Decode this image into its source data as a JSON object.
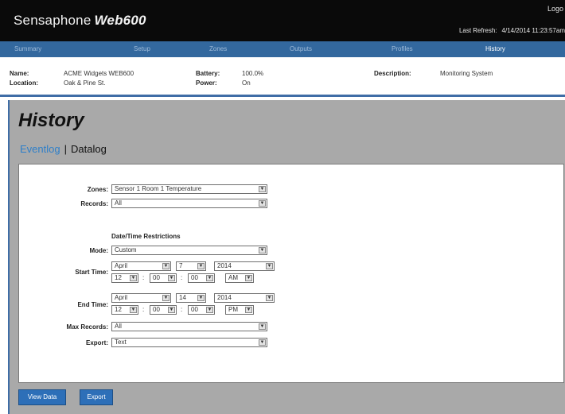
{
  "header": {
    "brand": "Sensaphone",
    "model": "Web600",
    "logout": "Logo",
    "last_refresh_label": "Last Refresh:",
    "last_refresh_value": "4/14/2014 11:23:57am"
  },
  "nav": {
    "items": [
      "Summary",
      "Setup",
      "Zones",
      "Outputs",
      "Profiles",
      "History"
    ],
    "active": "History"
  },
  "device": {
    "name_label": "Name:",
    "name_value": "ACME Widgets WEB600",
    "location_label": "Location:",
    "location_value": "Oak & Pine St.",
    "battery_label": "Battery:",
    "battery_value": "100.0%",
    "power_label": "Power:",
    "power_value": "On",
    "description_label": "Description:",
    "description_value": "Monitoring System"
  },
  "page": {
    "title": "History",
    "subnav_eventlog": "Eventlog",
    "subnav_sep": "|",
    "subnav_datalog": "Datalog"
  },
  "form": {
    "zones_label": "Zones:",
    "zones_value": "Sensor 1 Room 1 Temperature",
    "records_label": "Records:",
    "records_value": "All",
    "restrictions_heading": "Date/Time Restrictions",
    "mode_label": "Mode:",
    "mode_value": "Custom",
    "start_label": "Start Time:",
    "start": {
      "month": "April",
      "day": "7",
      "year": "2014",
      "hour": "12",
      "minute": "00",
      "second": "00",
      "ampm": "AM"
    },
    "end_label": "End Time:",
    "end": {
      "month": "April",
      "day": "14",
      "year": "2014",
      "hour": "12",
      "minute": "00",
      "second": "00",
      "ampm": "PM"
    },
    "max_records_label": "Max Records:",
    "max_records_value": "All",
    "export_label": "Export:",
    "export_value": "Text"
  },
  "buttons": {
    "view_data": "View Data",
    "export": "Export"
  },
  "colors": {
    "header_bg": "#0a0a0a",
    "nav_bg": "#33689e",
    "accent": "#2d6fb8",
    "main_bg": "#a9a9a9",
    "link": "#2e7fc9"
  }
}
